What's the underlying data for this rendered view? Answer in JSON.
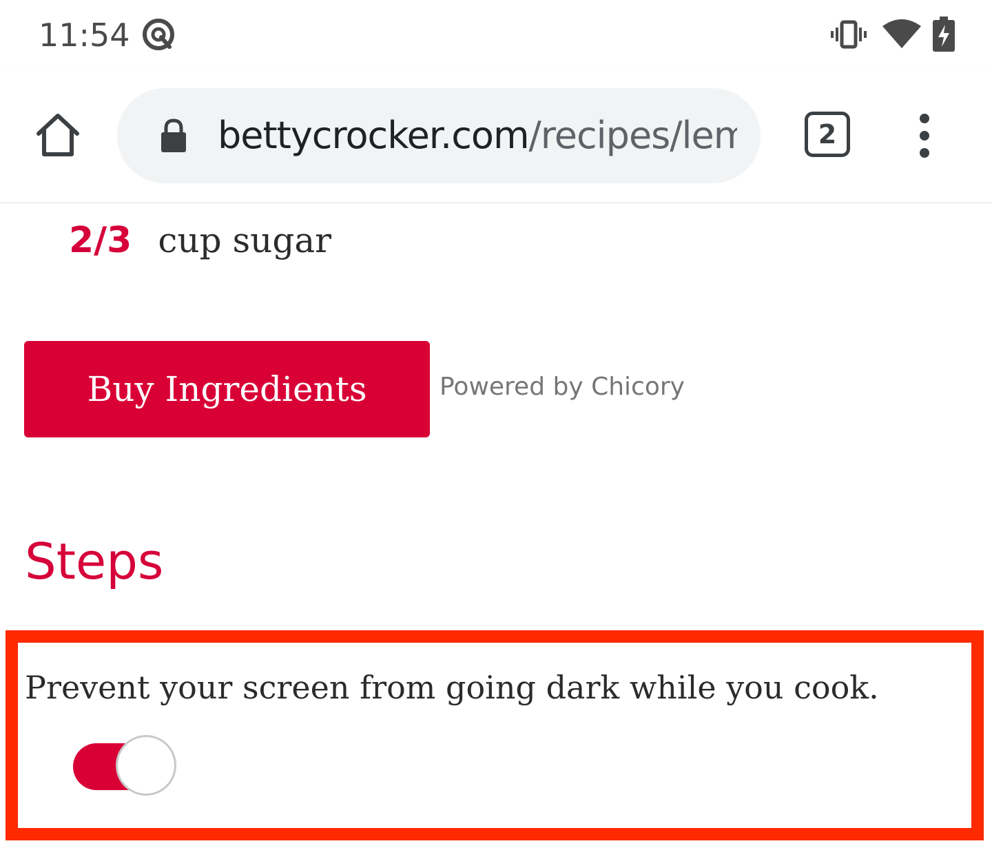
{
  "status_bar": {
    "time": "11:54",
    "icons": {
      "app": "assistant-circle-icon",
      "vibrate": "vibrate-icon",
      "wifi": "wifi-icon",
      "battery": "battery-charging-icon"
    }
  },
  "browser": {
    "url_domain": "bettycrocker.com",
    "url_path": "/recipes/lem",
    "tab_count": "2",
    "icons": {
      "home": "home-icon",
      "lock": "lock-icon",
      "menu": "more-vert-icon"
    }
  },
  "content": {
    "ingredient": {
      "quantity": "2/3",
      "name": "cup sugar"
    },
    "buy_button_label": "Buy Ingredients",
    "powered_by": "Powered by Chicory",
    "steps_heading": "Steps",
    "keep_awake": {
      "label": "Prevent your screen from going dark while you cook.",
      "enabled": true
    }
  },
  "colors": {
    "brand_red": "#d90036",
    "highlight_border": "#ff2a00",
    "toggle_on": "#d90036",
    "toggle_off": "#bdbdbd",
    "status_text": "#4a4a4a"
  }
}
